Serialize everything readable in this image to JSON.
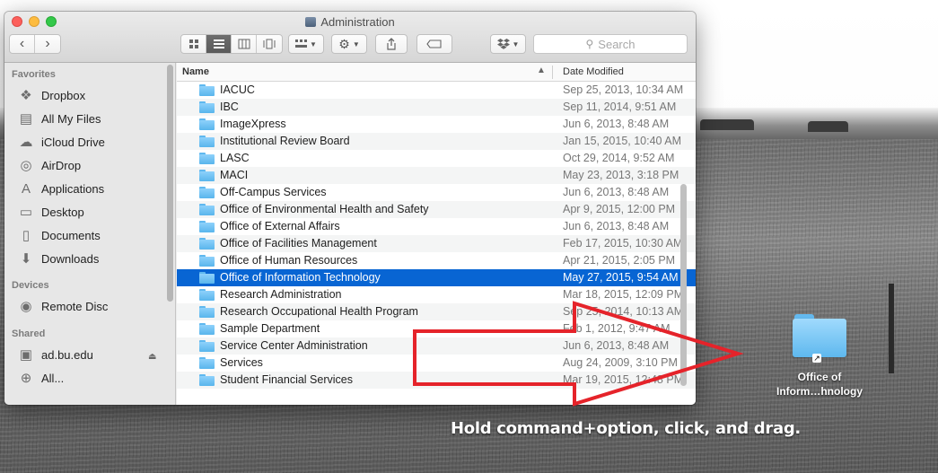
{
  "window": {
    "title": "Administration"
  },
  "toolbar": {
    "back": "‹",
    "forward": "›",
    "search_placeholder": "Search"
  },
  "sidebar": {
    "favorites_header": "Favorites",
    "favorites": [
      {
        "label": "Dropbox",
        "icon": "dropbox-icon"
      },
      {
        "label": "All My Files",
        "icon": "all-files-icon"
      },
      {
        "label": "iCloud Drive",
        "icon": "cloud-icon"
      },
      {
        "label": "AirDrop",
        "icon": "airdrop-icon"
      },
      {
        "label": "Applications",
        "icon": "applications-icon"
      },
      {
        "label": "Desktop",
        "icon": "desktop-icon"
      },
      {
        "label": "Documents",
        "icon": "documents-icon"
      },
      {
        "label": "Downloads",
        "icon": "downloads-icon"
      }
    ],
    "devices_header": "Devices",
    "devices": [
      {
        "label": "Remote Disc",
        "icon": "disc-icon"
      }
    ],
    "shared_header": "Shared",
    "shared": [
      {
        "label": "ad.bu.edu",
        "icon": "server-icon"
      },
      {
        "label": "All...",
        "icon": "network-icon"
      }
    ]
  },
  "list": {
    "col_name": "Name",
    "col_date": "Date Modified",
    "rows": [
      {
        "name": "IACUC",
        "date": "Sep 25, 2013, 10:34 AM"
      },
      {
        "name": "IBC",
        "date": "Sep 11, 2014, 9:51 AM"
      },
      {
        "name": "ImageXpress",
        "date": "Jun 6, 2013, 8:48 AM"
      },
      {
        "name": "Institutional Review Board",
        "date": "Jan 15, 2015, 10:40 AM"
      },
      {
        "name": "LASC",
        "date": "Oct 29, 2014, 9:52 AM"
      },
      {
        "name": "MACI",
        "date": "May 23, 2013, 3:18 PM"
      },
      {
        "name": "Off-Campus Services",
        "date": "Jun 6, 2013, 8:48 AM"
      },
      {
        "name": "Office of Environmental Health and Safety",
        "date": "Apr 9, 2015, 12:00 PM"
      },
      {
        "name": "Office of External Affairs",
        "date": "Jun 6, 2013, 8:48 AM"
      },
      {
        "name": "Office of Facilities Management",
        "date": "Feb 17, 2015, 10:30 AM"
      },
      {
        "name": "Office of Human Resources",
        "date": "Apr 21, 2015, 2:05 PM"
      },
      {
        "name": "Office of Information Technology",
        "date": "May 27, 2015, 9:54 AM",
        "selected": true
      },
      {
        "name": "Research Administration",
        "date": "Mar 18, 2015, 12:09 PM"
      },
      {
        "name": "Research Occupational Health Program",
        "date": "Sep 25, 2014, 10:13 AM"
      },
      {
        "name": "Sample Department",
        "date": "Feb 1, 2012, 9:47 AM"
      },
      {
        "name": "Service Center Administration",
        "date": "Jun 6, 2013, 8:48 AM"
      },
      {
        "name": "Services",
        "date": "Aug 24, 2009, 3:10 PM"
      },
      {
        "name": "Student Financial Services",
        "date": "Mar 19, 2015, 12:48 PM"
      }
    ]
  },
  "drag_item": {
    "label_line1": "Office of",
    "label_line2": "Inform…hnology"
  },
  "caption": "Hold command+option, click, and drag.",
  "colors": {
    "selection": "#0865d3",
    "arrow": "#e5232a",
    "folder": "#5eb8ee"
  }
}
